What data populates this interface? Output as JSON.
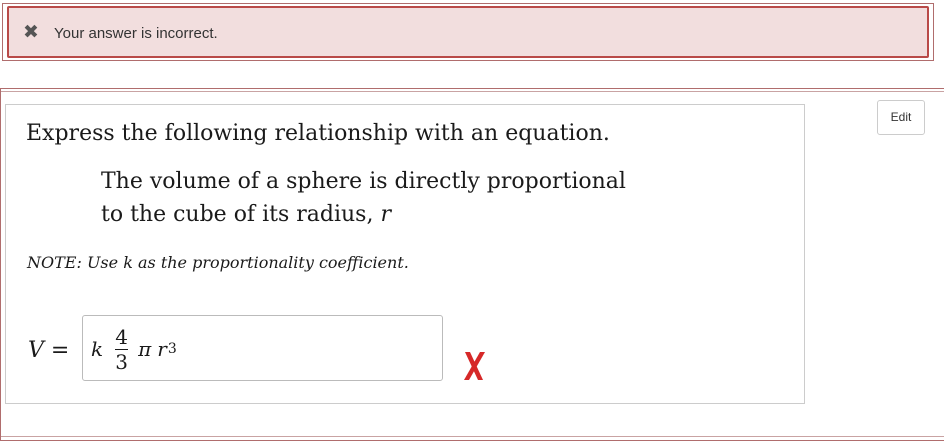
{
  "alert": {
    "icon": "x-icon",
    "message": "Your answer is incorrect."
  },
  "toolbar": {
    "edit_label": "Edit"
  },
  "question": {
    "instruction": "Express the following relationship with an equation.",
    "statement_line1": "The volume of a sphere is directly proportional",
    "statement_line2_prefix": "to the cube of its radius,",
    "statement_variable": "r",
    "note": "NOTE: Use k as the proportionality coefficient."
  },
  "answer": {
    "lhs_var": "V",
    "equals": "=",
    "k": "k",
    "frac_numerator": "4",
    "frac_denominator": "3",
    "pi": "π",
    "r": "r",
    "exponent": "3",
    "status": "incorrect",
    "status_icon": "red-x-icon",
    "status_color": "#d62828"
  },
  "colors": {
    "alert_bg": "#f2dede",
    "alert_border": "#b94a48"
  }
}
